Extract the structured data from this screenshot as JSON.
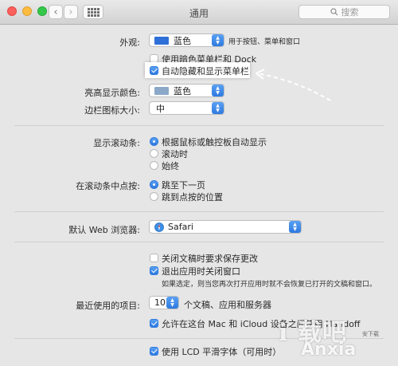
{
  "window": {
    "title": "通用"
  },
  "toolbar": {
    "search_placeholder": "搜索"
  },
  "colors": {
    "blue": "#2f6fd8",
    "graphite": "#8c9bb0",
    "accent": "#2e79df"
  },
  "appearance": {
    "label": "外观:",
    "value": "蓝色",
    "note": "用于按钮、菜单和窗口",
    "dark_menu_label": "使用暗色菜单栏和 Dock",
    "dark_menu_checked": false,
    "autohide_label": "自动隐藏和显示菜单栏",
    "autohide_checked": true
  },
  "highlight_color": {
    "label": "亮高显示颜色:",
    "value": "蓝色"
  },
  "sidebar_icon_size": {
    "label": "边栏图标大小:",
    "value": "中"
  },
  "scroll_bars": {
    "label": "显示滚动条:",
    "options": [
      "根据鼠标或触控板自动显示",
      "滚动时",
      "始终"
    ],
    "selected": 0
  },
  "click_scroll": {
    "label": "在滚动条中点按:",
    "options": [
      "跳至下一页",
      "跳到点按的位置"
    ],
    "selected": 0
  },
  "browser": {
    "label": "默认 Web 浏览器:",
    "value": "Safari"
  },
  "documents": {
    "ask_save_label": "关闭文稿时要求保存更改",
    "ask_save_checked": false,
    "close_windows_label": "退出应用时关闭窗口",
    "close_windows_checked": true,
    "close_windows_note": "如果选定，则当您再次打开应用时就不会恢复已打开的文稿和窗口。"
  },
  "recent": {
    "label": "最近使用的项目:",
    "value": "10",
    "suffix": "个文稿、应用和服务器"
  },
  "handoff": {
    "label": "允许在这台 Mac 和 iCloud 设备之间使用 Handoff",
    "checked": true
  },
  "lcd": {
    "label": "使用 LCD 平滑字体（可用时）",
    "checked": true
  },
  "watermark": {
    "line1": "i 载吧",
    "line2": "Anxia",
    "line3": "安下载"
  }
}
